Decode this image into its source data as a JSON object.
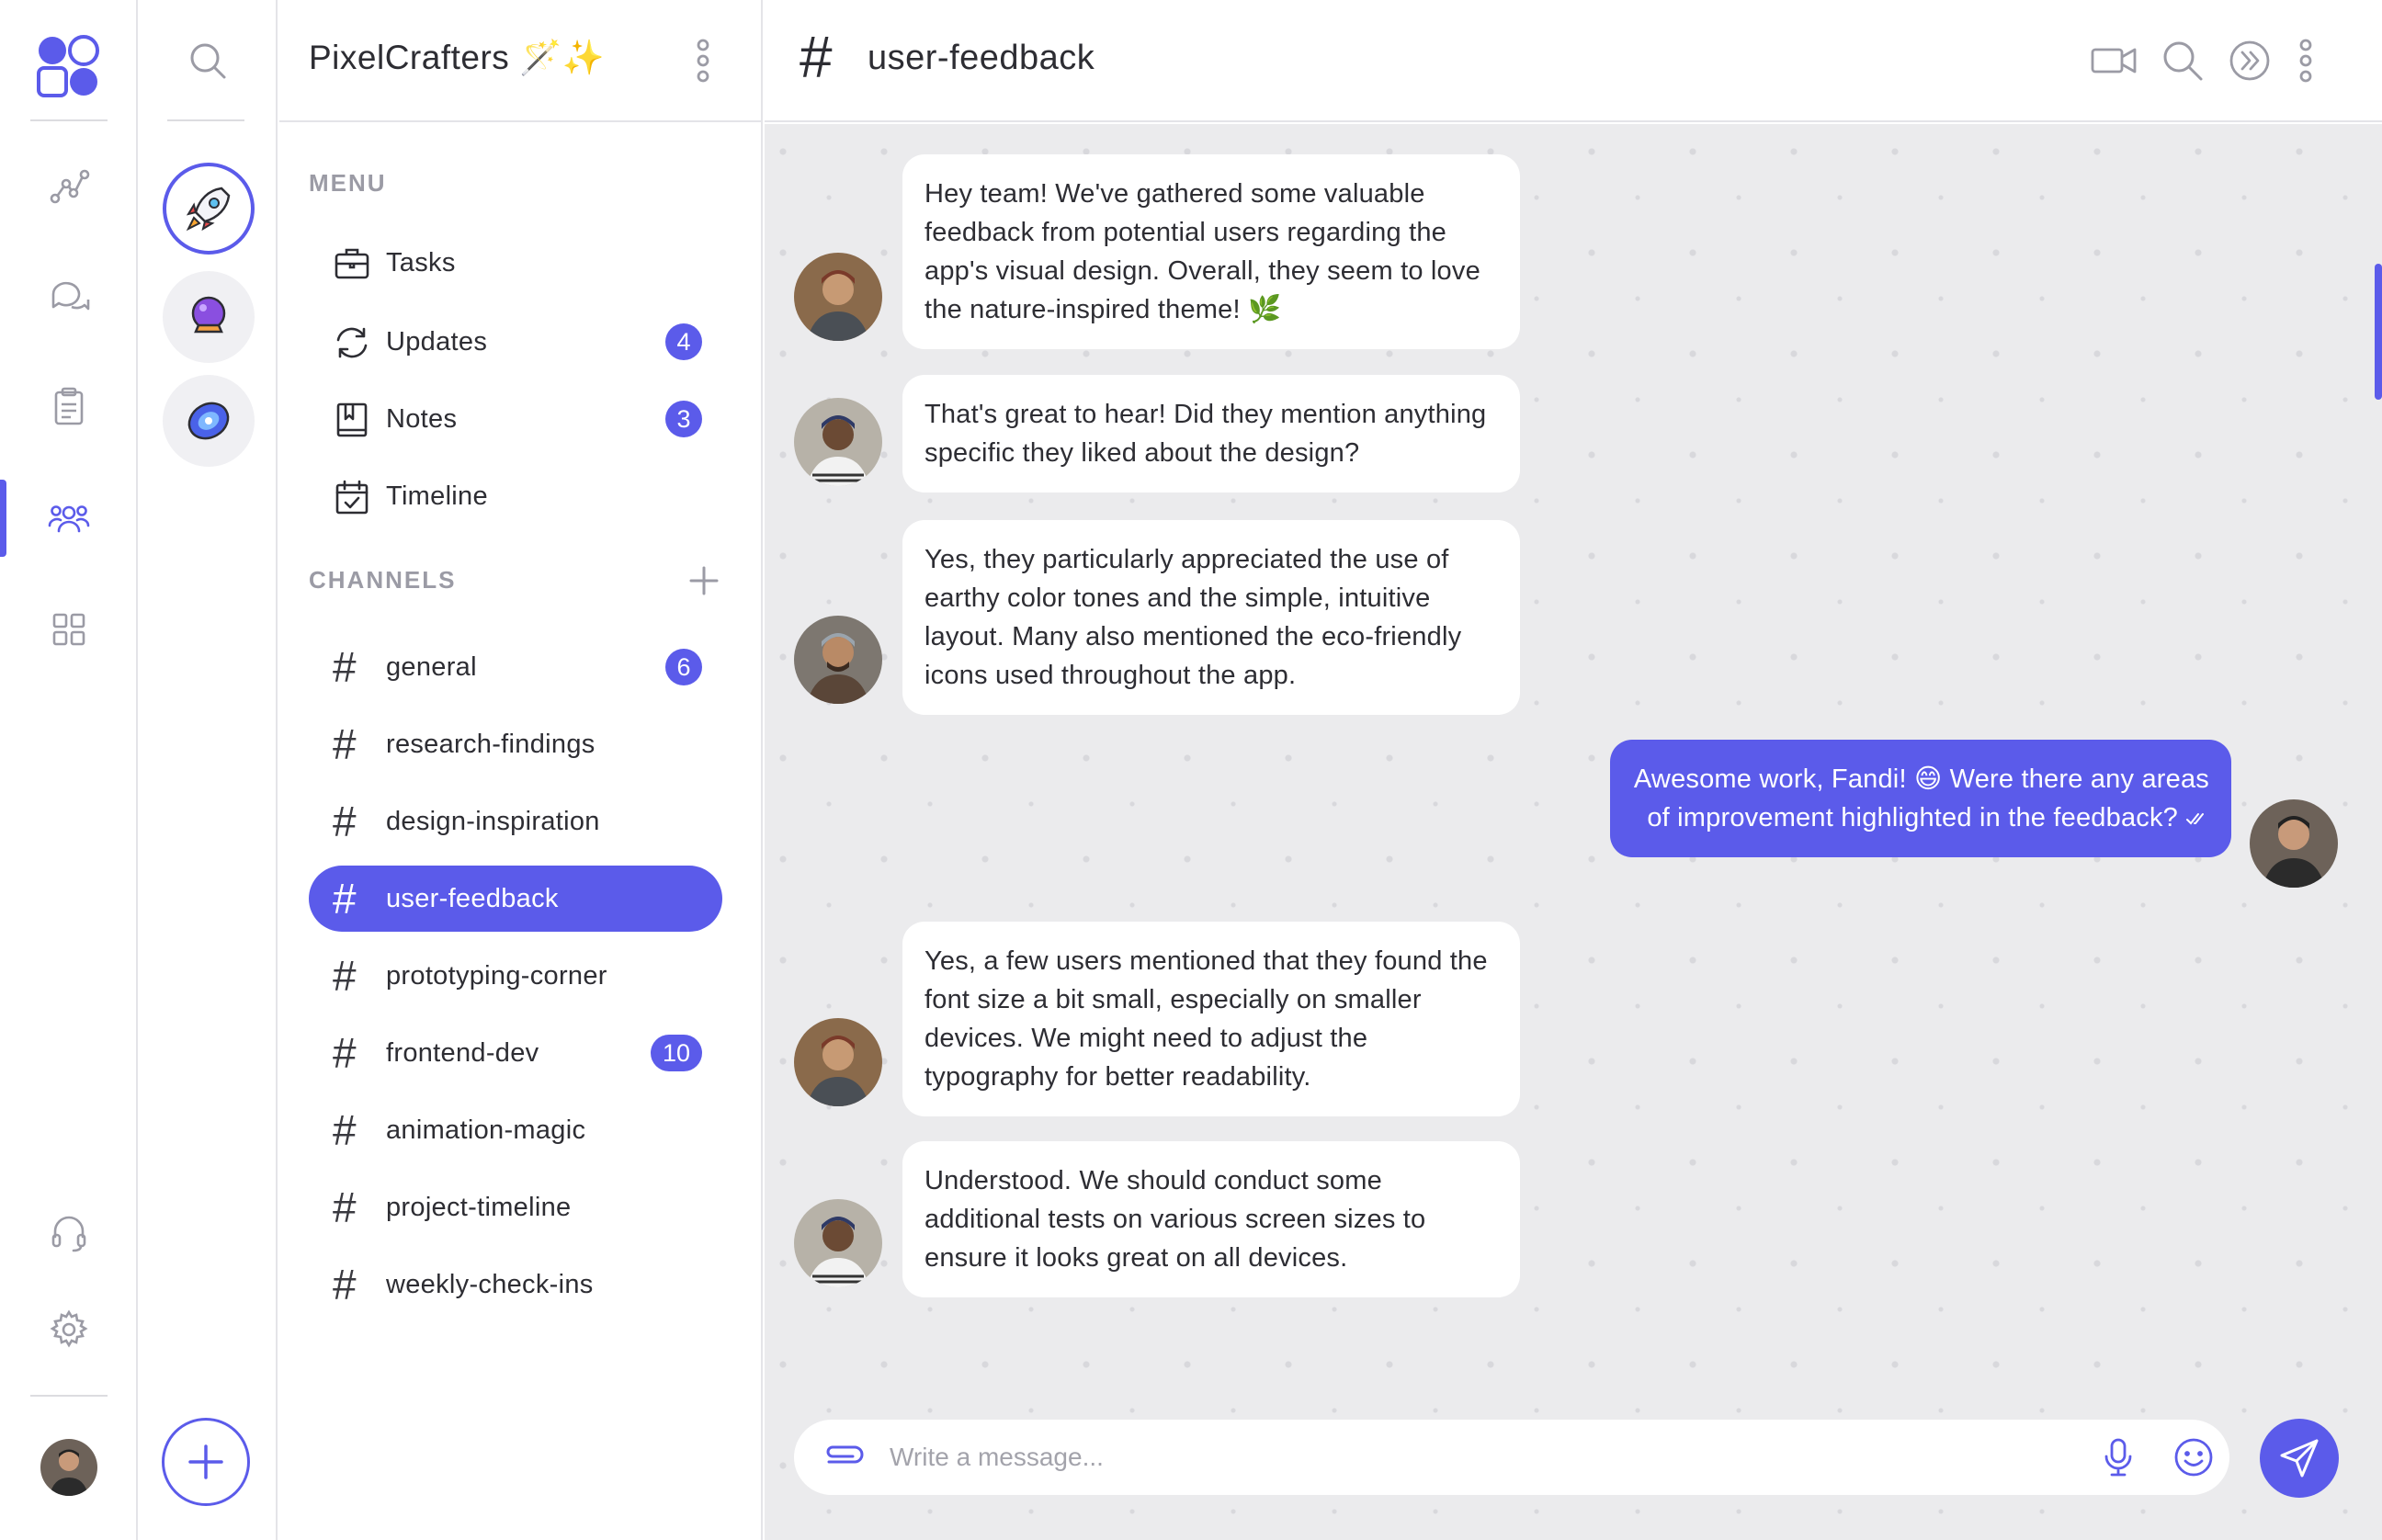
{
  "workspace": {
    "title": "PixelCrafters 🪄✨"
  },
  "rail": {
    "icons": [
      "logo-icon",
      "analytics-icon",
      "chat-icon",
      "clipboard-icon",
      "team-icon",
      "grid-icon",
      "headset-icon",
      "gear-icon"
    ],
    "active": "team-icon"
  },
  "workspaces": [
    "rocket-icon",
    "crystal-ball-icon",
    "galaxy-icon"
  ],
  "menu": {
    "label": "MENU",
    "items": [
      {
        "label": "Tasks",
        "icon": "briefcase-icon",
        "badge": ""
      },
      {
        "label": "Updates",
        "icon": "refresh-icon",
        "badge": "4"
      },
      {
        "label": "Notes",
        "icon": "notebook-icon",
        "badge": "3"
      },
      {
        "label": "Timeline",
        "icon": "calendar-check-icon",
        "badge": ""
      }
    ]
  },
  "channels": {
    "label": "CHANNELS",
    "items": [
      {
        "label": "general",
        "badge": "6"
      },
      {
        "label": "research-findings",
        "badge": ""
      },
      {
        "label": "design-inspiration",
        "badge": ""
      },
      {
        "label": "user-feedback",
        "badge": "",
        "active": true
      },
      {
        "label": "prototyping-corner",
        "badge": ""
      },
      {
        "label": "frontend-dev",
        "badge": "10"
      },
      {
        "label": "animation-magic",
        "badge": ""
      },
      {
        "label": "project-timeline",
        "badge": ""
      },
      {
        "label": "weekly-check-ins",
        "badge": ""
      }
    ]
  },
  "chat": {
    "hash": "#",
    "title": "user-feedback",
    "messages": [
      {
        "from": "other",
        "text": "Hey team! We've gathered some valuable feedback from potential users regarding the app's visual design. Overall, they seem to love the nature-inspired theme! 🌿"
      },
      {
        "from": "other2",
        "text": "That's great to hear! Did they mention anything specific they liked about the design?"
      },
      {
        "from": "other3",
        "text": "Yes, they particularly appreciated the use of earthy color tones and the simple, intuitive layout. Many also mentioned the eco-friendly icons used throughout the app."
      },
      {
        "from": "me",
        "text": "Awesome work, Fandi! 😄 Were there any areas of improvement highlighted in the feedback?"
      },
      {
        "from": "other",
        "text": "Yes, a few users mentioned that they found the font size a bit small, especially on smaller devices. We might need to adjust the typography for better readability."
      },
      {
        "from": "other2",
        "text": "Understood. We should conduct some additional tests on various screen sizes to ensure it looks great on all devices."
      }
    ],
    "composer_placeholder": "Write a message..."
  },
  "colors": {
    "accent": "#5b5bea",
    "chat_bg": "#ebebed",
    "text": "#2d2d33",
    "muted": "#9b9ba5"
  }
}
